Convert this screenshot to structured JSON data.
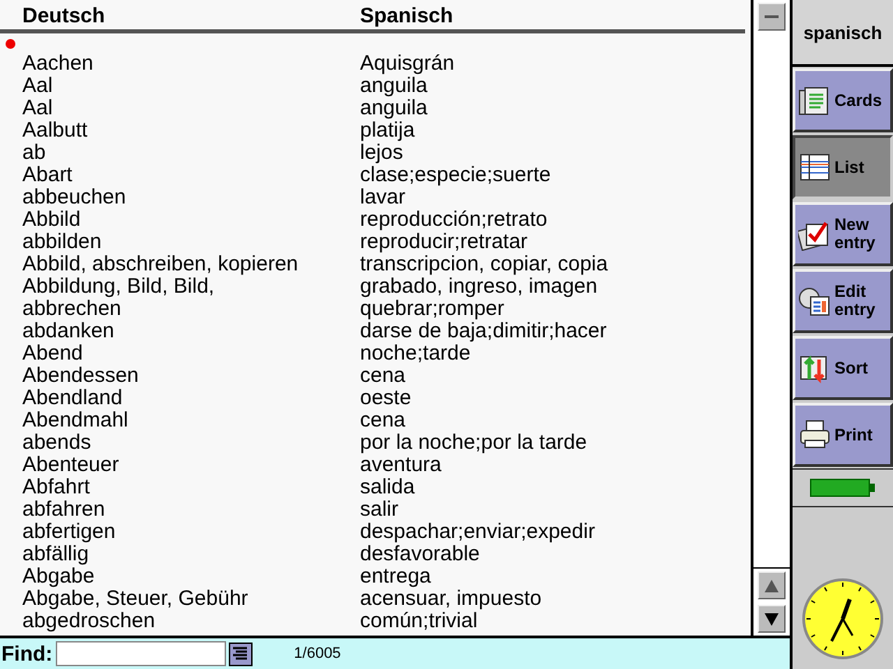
{
  "columns": [
    "Deutsch",
    "Spanisch"
  ],
  "rows": [
    [
      "Aachen",
      "Aquisgrán"
    ],
    [
      "Aal",
      "anguila"
    ],
    [
      "Aal",
      "anguila"
    ],
    [
      "Aalbutt",
      "platija"
    ],
    [
      "ab",
      "lejos"
    ],
    [
      "Abart",
      "clase;especie;suerte"
    ],
    [
      "abbeuchen",
      "lavar"
    ],
    [
      "Abbild",
      "reproducción;retrato"
    ],
    [
      "abbilden",
      "reproducir;retratar"
    ],
    [
      "Abbild, abschreiben, kopieren",
      "transcripcion, copiar, copia"
    ],
    [
      "Abbildung, Bild, Bild,",
      "grabado, ingreso, imagen"
    ],
    [
      "abbrechen",
      "quebrar;romper"
    ],
    [
      "abdanken",
      "darse de baja;dimitir;hacer"
    ],
    [
      "Abend",
      "noche;tarde"
    ],
    [
      "Abendessen",
      "cena"
    ],
    [
      "Abendland",
      "oeste"
    ],
    [
      "Abendmahl",
      "cena"
    ],
    [
      "abends",
      "por la noche;por la tarde"
    ],
    [
      "Abenteuer",
      "aventura"
    ],
    [
      "Abfahrt",
      "salida"
    ],
    [
      "abfahren",
      "salir"
    ],
    [
      "abfertigen",
      "despachar;enviar;expedir"
    ],
    [
      "abfällig",
      "desfavorable"
    ],
    [
      "Abgabe",
      "entrega"
    ],
    [
      "Abgabe, Steuer, Gebühr",
      "acensuar, impuesto"
    ],
    [
      "abgedroschen",
      "común;trivial"
    ]
  ],
  "find": {
    "label": "Find:",
    "count": "1/6005"
  },
  "sidebar": {
    "title": "spanisch",
    "items": [
      {
        "label": "Cards",
        "kind": "cards",
        "selected": false
      },
      {
        "label": "List",
        "kind": "list",
        "selected": true
      },
      {
        "label": "New entry",
        "kind": "new",
        "selected": false
      },
      {
        "label": "Edit entry",
        "kind": "edit",
        "selected": false
      },
      {
        "label": "Sort",
        "kind": "sort",
        "selected": false
      },
      {
        "label": "Print",
        "kind": "print",
        "selected": false
      }
    ]
  }
}
